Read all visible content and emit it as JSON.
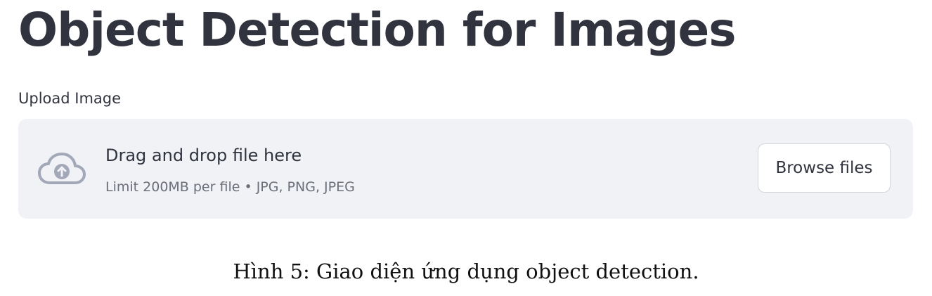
{
  "app": {
    "title": "Object Detection for Images"
  },
  "uploader": {
    "label": "Upload Image",
    "instruction": "Drag and drop file here",
    "limits": "Limit 200MB per file • JPG, PNG, JPEG",
    "browse_label": "Browse files",
    "icon": "cloud-upload-icon"
  },
  "figure": {
    "caption": "Hình 5: Giao diện ứng dụng object detection."
  },
  "colors": {
    "text": "#31333f",
    "muted_text": "#6c6f7a",
    "dropzone_bg": "#f0f2f6",
    "icon": "#a3a8b8"
  }
}
